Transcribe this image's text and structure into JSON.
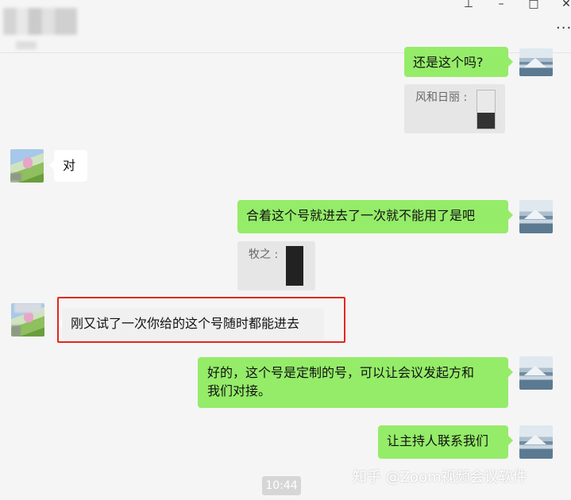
{
  "window": {
    "pin_icon": "pin-icon",
    "minimize_icon": "minimize-icon",
    "maximize_icon": "maximize-icon",
    "close_icon": "close-icon",
    "more_icon": "more-icon"
  },
  "colors": {
    "sent_bubble": "#95ec69",
    "received_bubble": "#ffffff",
    "highlight": "#e0281f"
  },
  "messages": [
    {
      "side": "right",
      "text": "还是这个吗?"
    },
    {
      "side": "right",
      "type": "quote",
      "author": "风和日丽 :"
    },
    {
      "side": "left",
      "text": "对"
    },
    {
      "side": "right",
      "text": "合着这个号就进去了一次就不能用了是吧"
    },
    {
      "side": "right",
      "type": "quote",
      "author": "牧之 :"
    },
    {
      "side": "left",
      "text": "刚又试了一次你给的这个号随时都能进去",
      "highlighted": true
    },
    {
      "side": "right",
      "text_line1": "好的，这个号是定制的号，可以让会议发起方和",
      "text_line2": "我们对接。"
    },
    {
      "side": "right",
      "text": "让主持人联系我们"
    }
  ],
  "timestamp": "10:44",
  "watermark": "知乎 @Zoom视频会议软件"
}
